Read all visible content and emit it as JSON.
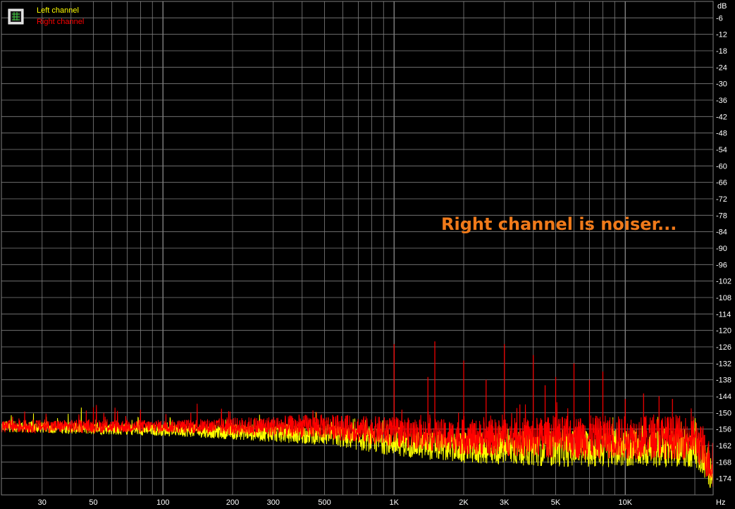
{
  "chart_data": {
    "type": "line",
    "title": "",
    "xlabel": "",
    "ylabel": "",
    "x_unit": "Hz",
    "y_unit": "dB",
    "x_scale": "log",
    "xlim": [
      20,
      24000
    ],
    "ylim": [
      -180,
      0
    ],
    "grid": true,
    "legend": "top-left",
    "background": "#000000",
    "grid_color": "#808080",
    "x_tick_labels": [
      "30",
      "50",
      "100",
      "200",
      "300",
      "500",
      "1K",
      "2K",
      "3K",
      "5K",
      "10K"
    ],
    "x_tick_values": [
      30,
      50,
      100,
      200,
      300,
      500,
      1000,
      2000,
      3000,
      5000,
      10000
    ],
    "y_tick_values": [
      -6,
      -12,
      -18,
      -24,
      -30,
      -36,
      -42,
      -48,
      -54,
      -60,
      -66,
      -72,
      -78,
      -84,
      -90,
      -96,
      -102,
      -108,
      -114,
      -120,
      -126,
      -132,
      -138,
      -144,
      -150,
      -156,
      -162,
      -168,
      -174
    ],
    "y_tick_labels": [
      "-6",
      "-12",
      "-18",
      "-24",
      "-30",
      "-36",
      "-42",
      "-48",
      "-54",
      "-60",
      "-66",
      "-72",
      "-78",
      "-84",
      "-90",
      "-96",
      "-102",
      "-108",
      "-114",
      "-120",
      "-126",
      "-132",
      "-138",
      "-144",
      "-150",
      "-156",
      "-162",
      "-168",
      "-174"
    ],
    "annotation": "Right channel is noiser...",
    "annotation_color": "#f07a1a",
    "series": [
      {
        "name": "Left channel",
        "color": "#ffff00",
        "noise_floor_db": [
          [
            20,
            -155
          ],
          [
            200,
            -157
          ],
          [
            500,
            -158
          ],
          [
            1000,
            -161
          ],
          [
            2000,
            -163
          ],
          [
            5000,
            -163
          ],
          [
            10000,
            -163
          ],
          [
            20000,
            -163
          ],
          [
            24000,
            -172
          ]
        ],
        "peaks": []
      },
      {
        "name": "Right channel",
        "color": "#ff0000",
        "noise_floor_db": [
          [
            20,
            -155
          ],
          [
            200,
            -155
          ],
          [
            500,
            -155
          ],
          [
            1000,
            -157
          ],
          [
            2000,
            -159
          ],
          [
            5000,
            -159
          ],
          [
            10000,
            -159
          ],
          [
            20000,
            -159
          ],
          [
            24000,
            -170
          ]
        ],
        "peaks": [
          {
            "x": 1000,
            "y": -125
          },
          {
            "x": 1400,
            "y": -137
          },
          {
            "x": 1500,
            "y": -124
          },
          {
            "x": 2000,
            "y": -131
          },
          {
            "x": 2500,
            "y": -138
          },
          {
            "x": 3000,
            "y": -125
          },
          {
            "x": 3500,
            "y": -147
          },
          {
            "x": 4000,
            "y": -129
          },
          {
            "x": 4500,
            "y": -140
          },
          {
            "x": 5000,
            "y": -137
          },
          {
            "x": 6000,
            "y": -132
          },
          {
            "x": 7000,
            "y": -138
          },
          {
            "x": 8000,
            "y": -135
          },
          {
            "x": 10000,
            "y": -145
          },
          {
            "x": 12000,
            "y": -143
          },
          {
            "x": 14000,
            "y": -144
          },
          {
            "x": 16000,
            "y": -145
          }
        ]
      }
    ]
  }
}
